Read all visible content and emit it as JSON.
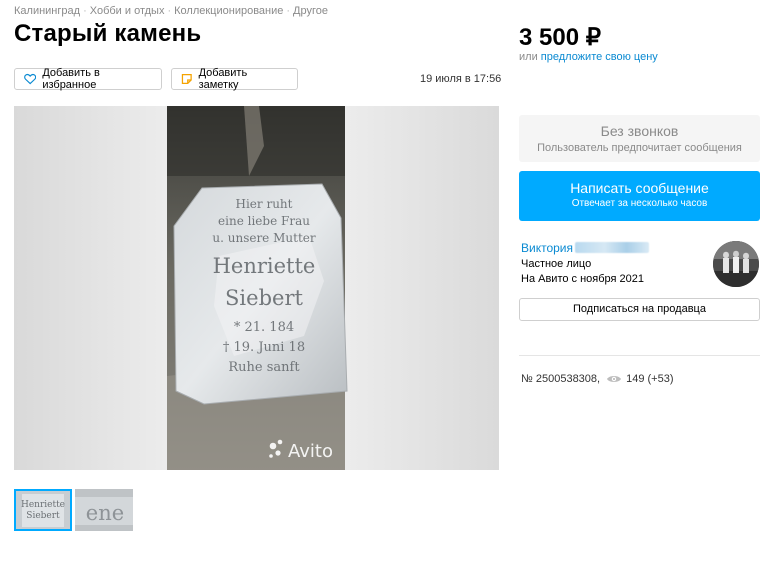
{
  "breadcrumbs": [
    "Калининград",
    "Хобби и отдых",
    "Коллекционирование",
    "Другое"
  ],
  "title": "Старый камень",
  "actions": {
    "favorite_label": "Добавить в избранное",
    "note_label": "Добавить заметку"
  },
  "date": "19 июля в 17:56",
  "gallery": {
    "watermark": "Avito",
    "stone_text": [
      "Hier ruht",
      "eine liebe Frau",
      "u. unsere Mutter",
      "Henriette",
      "Siebert",
      "* 21.    184",
      "† 19. Juni 18",
      "Ruhe sanft"
    ],
    "thumb2_text": "ene"
  },
  "price": {
    "value": "3 500 ₽",
    "or_label": "или",
    "offer_link": "предложите свою цену"
  },
  "no_calls": {
    "title": "Без звонков",
    "subtitle": "Пользователь предпочитает сообщения"
  },
  "message_button": {
    "title": "Написать сообщение",
    "subtitle": "Отвечает за несколько часов"
  },
  "seller": {
    "name": "Виктория",
    "type": "Частное лицо",
    "since": "На Авито с ноября 2021"
  },
  "subscribe_label": "Подписаться на продавца",
  "listing": {
    "number": "№ 2500538308,",
    "views": "149 (+53)"
  },
  "colors": {
    "accent": "#00aaff",
    "link": "#0a8ad2",
    "muted": "#8a8a8a"
  }
}
